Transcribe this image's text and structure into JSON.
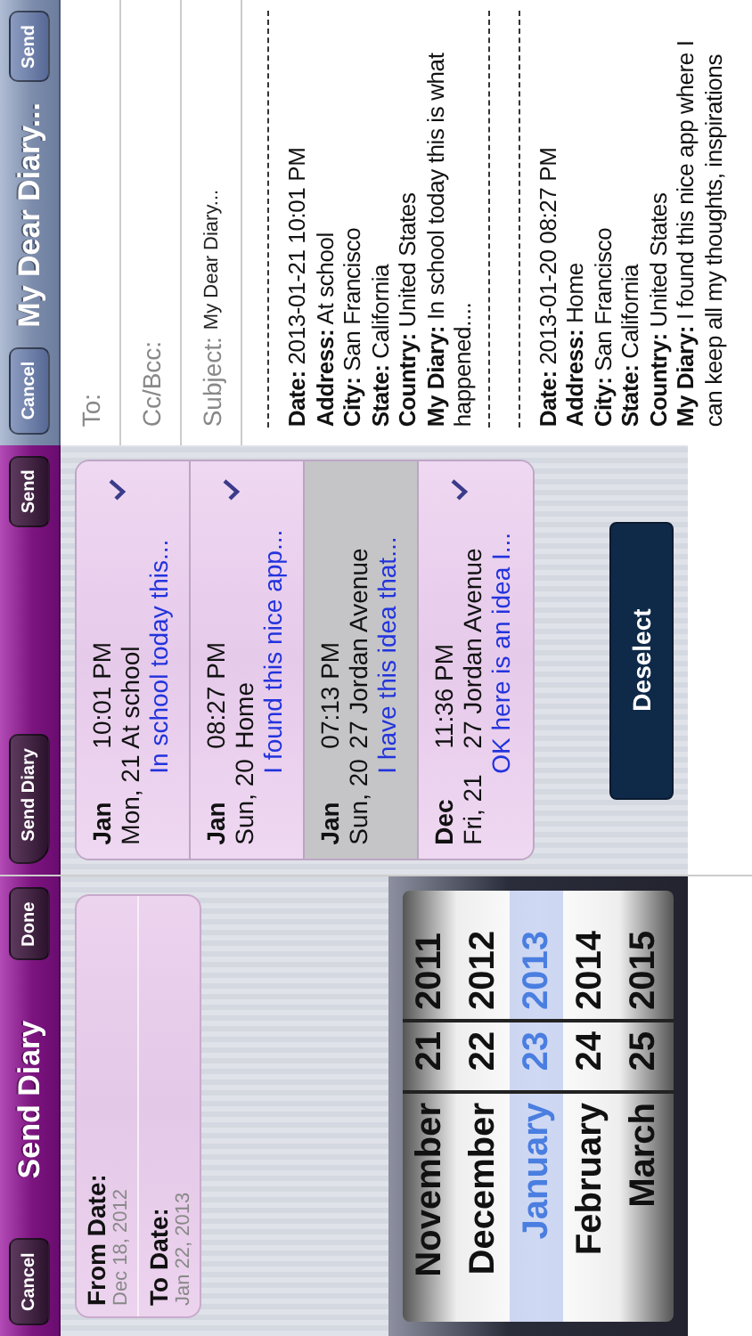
{
  "send_diary_form": {
    "nav": {
      "cancel": "Cancel",
      "title": "Send Diary",
      "done": "Done"
    },
    "fields": [
      {
        "label": "From Date:",
        "value": "Dec 18, 2012"
      },
      {
        "label": "To Date:",
        "value": "Jan 22, 2013"
      }
    ],
    "picker": {
      "columns": [
        {
          "kind": "month",
          "items": [
            {
              "label": "November",
              "selected": false
            },
            {
              "label": "December",
              "selected": false
            },
            {
              "label": "January",
              "selected": true
            },
            {
              "label": "February",
              "selected": false
            },
            {
              "label": "March",
              "selected": false
            }
          ]
        },
        {
          "kind": "day",
          "items": [
            {
              "label": "21",
              "selected": false
            },
            {
              "label": "22",
              "selected": false
            },
            {
              "label": "23",
              "selected": true
            },
            {
              "label": "24",
              "selected": false
            },
            {
              "label": "25",
              "selected": false
            }
          ]
        },
        {
          "kind": "year",
          "items": [
            {
              "label": "2011",
              "selected": false
            },
            {
              "label": "2012",
              "selected": false
            },
            {
              "label": "2013",
              "selected": true
            },
            {
              "label": "2014",
              "selected": false
            },
            {
              "label": "2015",
              "selected": false
            }
          ]
        }
      ]
    }
  },
  "entry_list": {
    "nav": {
      "back": "Send Diary",
      "send": "Send"
    },
    "entries": [
      {
        "month": "Jan",
        "day": "Mon, 21",
        "time": "10:01 PM",
        "place": "At school",
        "excerpt": "In school today this...",
        "checked": true
      },
      {
        "month": "Jan",
        "day": "Sun, 20",
        "time": "08:27 PM",
        "place": "Home",
        "excerpt": "I found this nice app...",
        "checked": true
      },
      {
        "month": "Jan",
        "day": "Sun, 20",
        "time": "07:13 PM",
        "place": "27 Jordan Avenue",
        "excerpt": "I have this idea that...",
        "checked": false
      },
      {
        "month": "Dec",
        "day": "Fri, 21",
        "time": "11:36 PM",
        "place": "27 Jordan Avenue",
        "excerpt": "OK here is an idea I...",
        "checked": true
      }
    ],
    "deselect": "Deselect"
  },
  "mail": {
    "nav": {
      "cancel": "Cancel",
      "title": "My Dear Diary...",
      "send": "Send"
    },
    "to_label": "To:",
    "cc_label": "Cc/Bcc:",
    "subject_label": "Subject:",
    "subject": "My Dear Diary...",
    "entries": [
      {
        "lines": [
          "**Date:** 2013-01-21 10:01 PM",
          "**Address:** At school",
          "**City:** San Francisco",
          "**State:** California",
          "**Country:** United States",
          "**My Diary:** In school today this is what happened...."
        ]
      },
      {
        "lines": [
          "**Date:** 2013-01-20 08:27 PM",
          "**Address:** Home",
          "**City:** San Francisco",
          "**State:** California",
          "**Country:** United States",
          "**My Diary:** I found this nice app where I can keep all my thoughts, inspirations"
        ]
      }
    ]
  }
}
